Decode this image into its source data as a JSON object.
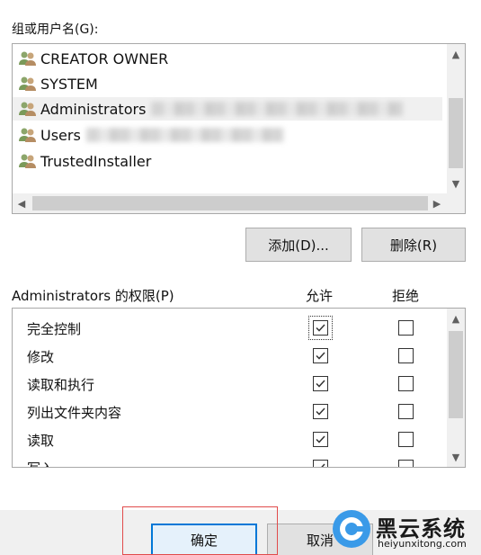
{
  "groups": {
    "label": "组或用户名(G):",
    "items": [
      {
        "name": "CREATOR OWNER"
      },
      {
        "name": "SYSTEM"
      },
      {
        "name": "Administrators"
      },
      {
        "name": "Users"
      },
      {
        "name": "TrustedInstaller"
      }
    ],
    "selected_index": 2
  },
  "buttons": {
    "add": "添加(D)...",
    "remove": "删除(R)"
  },
  "permissions": {
    "title": "Administrators 的权限(P)",
    "allow_header": "允许",
    "deny_header": "拒绝",
    "rows": [
      {
        "name": "完全控制",
        "allow": true,
        "deny": false
      },
      {
        "name": "修改",
        "allow": true,
        "deny": false
      },
      {
        "name": "读取和执行",
        "allow": true,
        "deny": false
      },
      {
        "name": "列出文件夹内容",
        "allow": true,
        "deny": false
      },
      {
        "name": "读取",
        "allow": true,
        "deny": false
      },
      {
        "name": "写入",
        "allow": true,
        "deny": false
      }
    ]
  },
  "dialog_buttons": {
    "ok": "确定",
    "cancel": "取消"
  },
  "watermark": {
    "title": "黑云系统",
    "url": "heiyunxitong.com"
  },
  "colors": {
    "highlight": "#e14b4b",
    "selected_bg": "#f0f0f0"
  }
}
